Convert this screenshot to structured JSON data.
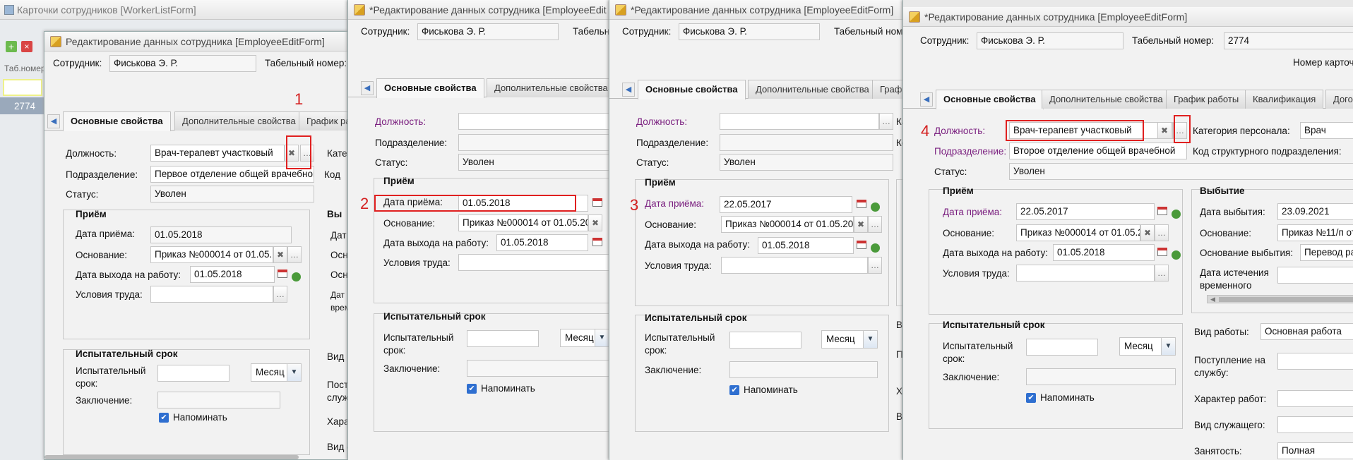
{
  "annotations": [
    "1",
    "2",
    "3",
    "4"
  ],
  "bg": {
    "title": "Карточки сотрудников [WorkerListForm]",
    "col": "Таб.номер",
    "row": "2774"
  },
  "edit_title": "Редактирование данных сотрудника [EmployeeEditForm]",
  "edit_title_star": "*Редактирование данных сотрудника [EmployeeEditForm]",
  "edit_title_star_short": "*Редактирование данных сотрудника [EmployeeEdit",
  "edit_title_star_mid": "*Редактирование данных сотрудника [EmployeeEditForm]",
  "labels": {
    "employee": "Сотрудник:",
    "tabnum": "Табельный номер:",
    "tabnum_short": "Табельный",
    "tabnum_short2": "Табельный ном",
    "position": "Должность:",
    "division": "Подразделение:",
    "status": "Статус:",
    "hiring": "Приём",
    "hire_date": "Дата приёма:",
    "basis": "Основание:",
    "work_start": "Дата выхода на работу:",
    "conditions": "Условия труда:",
    "probation": "Испытательный срок",
    "probation_field": "Испытательный срок:",
    "conclusion": "Заключение:",
    "remind": "Напоминать",
    "category": "Категория персонала:",
    "categ_short": "Катег",
    "struct_code": "Код структурного подразделения:",
    "code_short": "Код",
    "leaving": "Выбытие",
    "leave_short": "Вы",
    "leave_date": "Дата выбытия:",
    "leave_basis": "Основание выбытия:",
    "temp_exp": "Дата истечения временного",
    "work_type": "Вид работы:",
    "service_entry": "Поступление на службу:",
    "work_nature": "Характер работ:",
    "employee_type": "Вид служащего:",
    "employment": "Занятость:",
    "card_num": "Номер карточ",
    "vid_r": "Вид р",
    "post_sl": "Пост служ",
    "hara": "Хара",
    "vid_s": "Вид с",
    "dat": "Дат",
    "osn": "Осн",
    "osn2": "Осн",
    "dat_vr": "Дат врем",
    "ka": "Ка",
    "ko": "Ко",
    "v": "В",
    "p": "П",
    "x": "Х"
  },
  "tabs": {
    "main": "Основные свойства",
    "extra": "Дополнительные свойства",
    "schedule": "График работы",
    "schedule_short": "График ра",
    "qual": "Квалификация",
    "contracts": "Догов",
    "graf": "Граф"
  },
  "values": {
    "employee": "Фиськова Э. Р.",
    "tabnum": "2774",
    "position": "Врач-терапевт участковый",
    "division1": "Первое отделение общей врачебной",
    "division2": "Второе отделение общей врачебной",
    "status": "Уволен",
    "date_0105": "01.05.2018",
    "date_2205": "22.05.2017",
    "basis": "Приказ №000014 от 01.05.20",
    "unit": "Месяц",
    "category": "Врач",
    "leave_date": "23.09.2021",
    "leave_basis": "Приказ №11/п от",
    "leave_reason": "Перевод ра",
    "work_type": "Основная работа",
    "employment": "Полная"
  }
}
